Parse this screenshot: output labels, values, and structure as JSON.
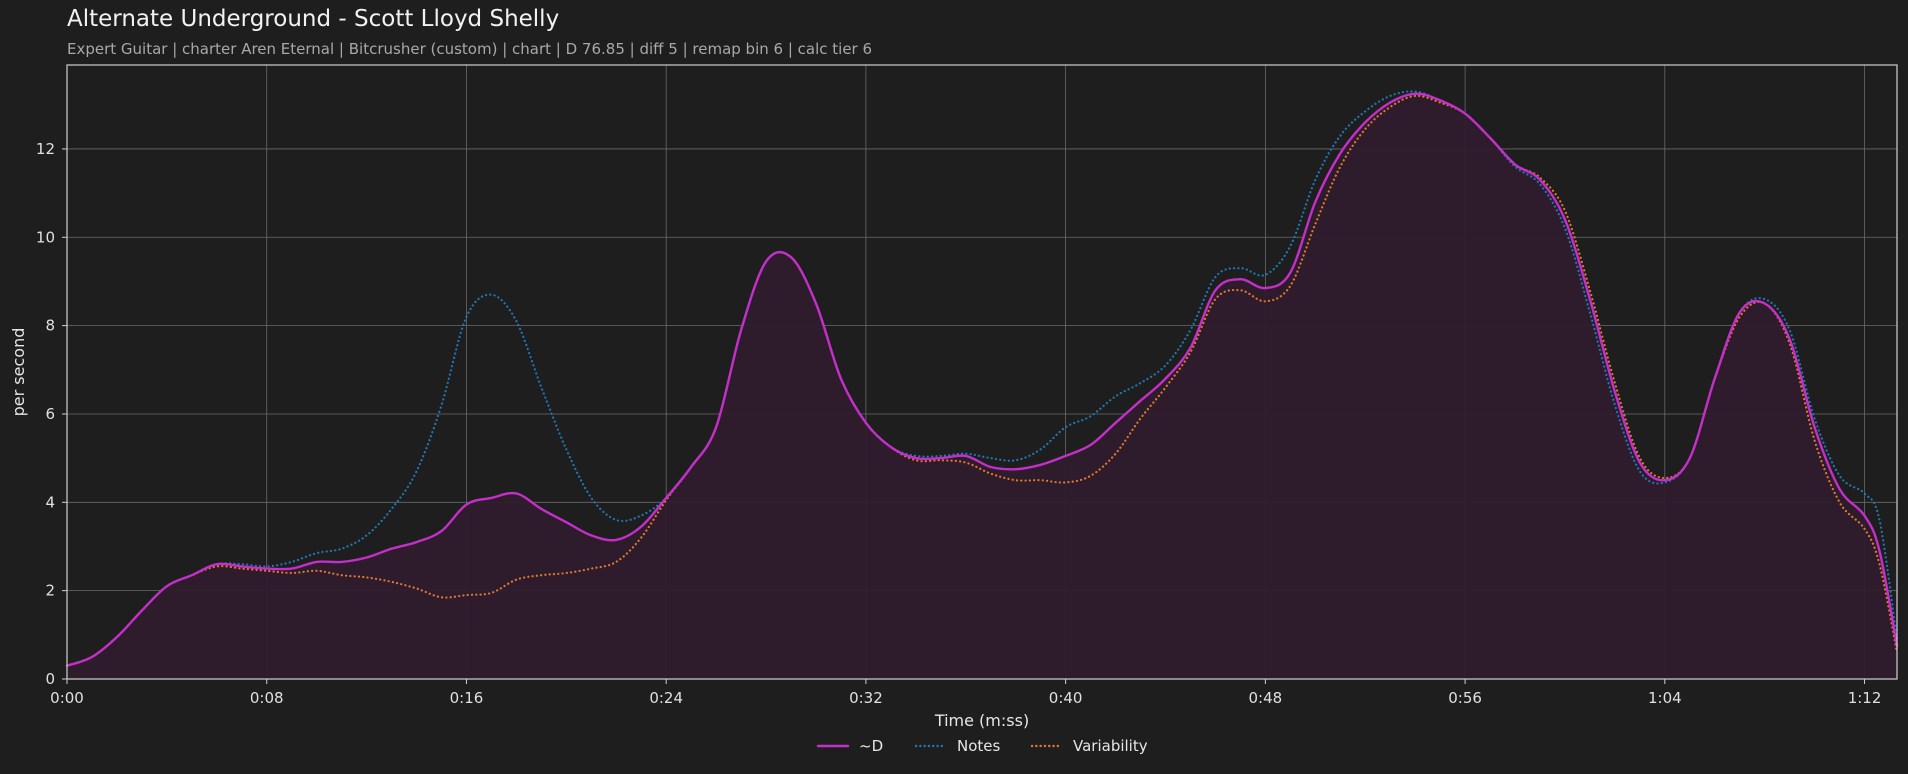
{
  "chart_data": {
    "type": "line",
    "title": "Alternate Underground - Scott Lloyd Shelly",
    "subtitle": "Expert Guitar  |  charter Aren Eternal  |  Bitcrusher (custom)  |  chart  |  D 76.85  |  diff 5  |  remap bin 6  |  calc tier 6",
    "xlabel": "Time (m:ss)",
    "ylabel": "per second",
    "xlim": [
      0,
      73.3
    ],
    "ylim": [
      0,
      13.9
    ],
    "x_ticks": [
      {
        "v": 0,
        "label": "0:00"
      },
      {
        "v": 8,
        "label": "0:08"
      },
      {
        "v": 16,
        "label": "0:16"
      },
      {
        "v": 24,
        "label": "0:24"
      },
      {
        "v": 32,
        "label": "0:32"
      },
      {
        "v": 40,
        "label": "0:40"
      },
      {
        "v": 48,
        "label": "0:48"
      },
      {
        "v": 56,
        "label": "0:56"
      },
      {
        "v": 64,
        "label": "1:04"
      },
      {
        "v": 72,
        "label": "1:12"
      }
    ],
    "y_ticks": [
      {
        "v": 0,
        "label": "0"
      },
      {
        "v": 2,
        "label": "2"
      },
      {
        "v": 4,
        "label": "4"
      },
      {
        "v": 6,
        "label": "6"
      },
      {
        "v": 8,
        "label": "8"
      },
      {
        "v": 10,
        "label": "10"
      },
      {
        "v": 12,
        "label": "12"
      }
    ],
    "grid": true,
    "legend_position": "bottom-center",
    "series": [
      {
        "name": "~D",
        "color": "#c42fc9",
        "style": "solid",
        "fill": "#2f1c2e",
        "points": [
          [
            0,
            0.3
          ],
          [
            1,
            0.5
          ],
          [
            2,
            0.95
          ],
          [
            3,
            1.55
          ],
          [
            4,
            2.1
          ],
          [
            5,
            2.35
          ],
          [
            6,
            2.6
          ],
          [
            7,
            2.55
          ],
          [
            8,
            2.5
          ],
          [
            9,
            2.5
          ],
          [
            10,
            2.65
          ],
          [
            11,
            2.65
          ],
          [
            12,
            2.75
          ],
          [
            13,
            2.95
          ],
          [
            14,
            3.1
          ],
          [
            15,
            3.35
          ],
          [
            16,
            3.95
          ],
          [
            17,
            4.1
          ],
          [
            18,
            4.2
          ],
          [
            19,
            3.85
          ],
          [
            20,
            3.55
          ],
          [
            21,
            3.25
          ],
          [
            22,
            3.15
          ],
          [
            23,
            3.45
          ],
          [
            24,
            4.1
          ],
          [
            25,
            4.8
          ],
          [
            26,
            5.7
          ],
          [
            27,
            7.9
          ],
          [
            28,
            9.45
          ],
          [
            29,
            9.55
          ],
          [
            30,
            8.5
          ],
          [
            31,
            6.8
          ],
          [
            32,
            5.8
          ],
          [
            33,
            5.25
          ],
          [
            34,
            5.0
          ],
          [
            35,
            5.0
          ],
          [
            36,
            5.05
          ],
          [
            37,
            4.8
          ],
          [
            38,
            4.75
          ],
          [
            39,
            4.85
          ],
          [
            40,
            5.05
          ],
          [
            41,
            5.3
          ],
          [
            42,
            5.8
          ],
          [
            43,
            6.3
          ],
          [
            44,
            6.8
          ],
          [
            45,
            7.5
          ],
          [
            46,
            8.8
          ],
          [
            47,
            9.05
          ],
          [
            48,
            8.85
          ],
          [
            49,
            9.2
          ],
          [
            50,
            10.8
          ],
          [
            51,
            11.9
          ],
          [
            52,
            12.6
          ],
          [
            53,
            13.05
          ],
          [
            54,
            13.25
          ],
          [
            55,
            13.1
          ],
          [
            56,
            12.8
          ],
          [
            57,
            12.25
          ],
          [
            58,
            11.65
          ],
          [
            59,
            11.3
          ],
          [
            60,
            10.4
          ],
          [
            61,
            8.6
          ],
          [
            62,
            6.5
          ],
          [
            63,
            4.9
          ],
          [
            64,
            4.5
          ],
          [
            65,
            5.0
          ],
          [
            66,
            6.8
          ],
          [
            67,
            8.3
          ],
          [
            68,
            8.5
          ],
          [
            69,
            7.7
          ],
          [
            70,
            5.7
          ],
          [
            71,
            4.3
          ],
          [
            72,
            3.7
          ],
          [
            72.6,
            2.9
          ],
          [
            73.3,
            0.75
          ]
        ]
      },
      {
        "name": "Notes",
        "color": "#1f77b4",
        "style": "dotted",
        "points": [
          [
            0,
            0.3
          ],
          [
            1,
            0.5
          ],
          [
            2,
            0.95
          ],
          [
            3,
            1.55
          ],
          [
            4,
            2.1
          ],
          [
            5,
            2.35
          ],
          [
            6,
            2.6
          ],
          [
            7,
            2.6
          ],
          [
            8,
            2.55
          ],
          [
            9,
            2.65
          ],
          [
            10,
            2.85
          ],
          [
            11,
            2.95
          ],
          [
            12,
            3.25
          ],
          [
            13,
            3.85
          ],
          [
            14,
            4.7
          ],
          [
            15,
            6.2
          ],
          [
            16,
            8.2
          ],
          [
            17,
            8.7
          ],
          [
            18,
            8.1
          ],
          [
            19,
            6.6
          ],
          [
            20,
            5.2
          ],
          [
            21,
            4.1
          ],
          [
            22,
            3.6
          ],
          [
            23,
            3.7
          ],
          [
            24,
            4.1
          ],
          [
            25,
            4.8
          ],
          [
            26,
            5.7
          ],
          [
            27,
            7.9
          ],
          [
            28,
            9.45
          ],
          [
            29,
            9.55
          ],
          [
            30,
            8.5
          ],
          [
            31,
            6.8
          ],
          [
            32,
            5.8
          ],
          [
            33,
            5.25
          ],
          [
            34,
            5.05
          ],
          [
            35,
            5.05
          ],
          [
            36,
            5.1
          ],
          [
            37,
            5.0
          ],
          [
            38,
            4.95
          ],
          [
            39,
            5.2
          ],
          [
            40,
            5.7
          ],
          [
            41,
            5.95
          ],
          [
            42,
            6.4
          ],
          [
            43,
            6.7
          ],
          [
            44,
            7.1
          ],
          [
            45,
            7.9
          ],
          [
            46,
            9.1
          ],
          [
            47,
            9.3
          ],
          [
            48,
            9.15
          ],
          [
            49,
            9.8
          ],
          [
            50,
            11.3
          ],
          [
            51,
            12.3
          ],
          [
            52,
            12.85
          ],
          [
            53,
            13.2
          ],
          [
            54,
            13.3
          ],
          [
            55,
            13.1
          ],
          [
            56,
            12.8
          ],
          [
            57,
            12.25
          ],
          [
            58,
            11.6
          ],
          [
            59,
            11.2
          ],
          [
            60,
            10.2
          ],
          [
            61,
            8.3
          ],
          [
            62,
            6.2
          ],
          [
            63,
            4.7
          ],
          [
            64,
            4.45
          ],
          [
            65,
            5.0
          ],
          [
            66,
            6.8
          ],
          [
            67,
            8.3
          ],
          [
            68,
            8.6
          ],
          [
            69,
            7.9
          ],
          [
            70,
            5.9
          ],
          [
            71,
            4.6
          ],
          [
            72,
            4.2
          ],
          [
            72.6,
            3.6
          ],
          [
            73.3,
            0.9
          ]
        ]
      },
      {
        "name": "Variability",
        "color": "#e0782c",
        "style": "dotted",
        "points": [
          [
            0,
            0.3
          ],
          [
            1,
            0.5
          ],
          [
            2,
            0.95
          ],
          [
            3,
            1.55
          ],
          [
            4,
            2.1
          ],
          [
            5,
            2.35
          ],
          [
            6,
            2.55
          ],
          [
            7,
            2.5
          ],
          [
            8,
            2.45
          ],
          [
            9,
            2.4
          ],
          [
            10,
            2.45
          ],
          [
            11,
            2.35
          ],
          [
            12,
            2.3
          ],
          [
            13,
            2.2
          ],
          [
            14,
            2.05
          ],
          [
            15,
            1.85
          ],
          [
            16,
            1.9
          ],
          [
            17,
            1.95
          ],
          [
            18,
            2.25
          ],
          [
            19,
            2.35
          ],
          [
            20,
            2.4
          ],
          [
            21,
            2.5
          ],
          [
            22,
            2.65
          ],
          [
            23,
            3.2
          ],
          [
            24,
            4.05
          ],
          [
            25,
            4.8
          ],
          [
            26,
            5.7
          ],
          [
            27,
            7.9
          ],
          [
            28,
            9.45
          ],
          [
            29,
            9.55
          ],
          [
            30,
            8.5
          ],
          [
            31,
            6.8
          ],
          [
            32,
            5.8
          ],
          [
            33,
            5.25
          ],
          [
            34,
            4.95
          ],
          [
            35,
            4.95
          ],
          [
            36,
            4.9
          ],
          [
            37,
            4.65
          ],
          [
            38,
            4.5
          ],
          [
            39,
            4.5
          ],
          [
            40,
            4.45
          ],
          [
            41,
            4.6
          ],
          [
            42,
            5.1
          ],
          [
            43,
            5.9
          ],
          [
            44,
            6.6
          ],
          [
            45,
            7.4
          ],
          [
            46,
            8.6
          ],
          [
            47,
            8.8
          ],
          [
            48,
            8.55
          ],
          [
            49,
            8.9
          ],
          [
            50,
            10.3
          ],
          [
            51,
            11.6
          ],
          [
            52,
            12.45
          ],
          [
            53,
            12.95
          ],
          [
            54,
            13.2
          ],
          [
            55,
            13.05
          ],
          [
            56,
            12.8
          ],
          [
            57,
            12.25
          ],
          [
            58,
            11.65
          ],
          [
            59,
            11.35
          ],
          [
            60,
            10.6
          ],
          [
            61,
            8.8
          ],
          [
            62,
            6.7
          ],
          [
            63,
            5.0
          ],
          [
            64,
            4.55
          ],
          [
            65,
            5.0
          ],
          [
            66,
            6.8
          ],
          [
            67,
            8.2
          ],
          [
            68,
            8.5
          ],
          [
            69,
            7.6
          ],
          [
            70,
            5.4
          ],
          [
            71,
            4.0
          ],
          [
            72,
            3.4
          ],
          [
            72.6,
            2.6
          ],
          [
            73.3,
            0.6
          ]
        ]
      }
    ]
  }
}
